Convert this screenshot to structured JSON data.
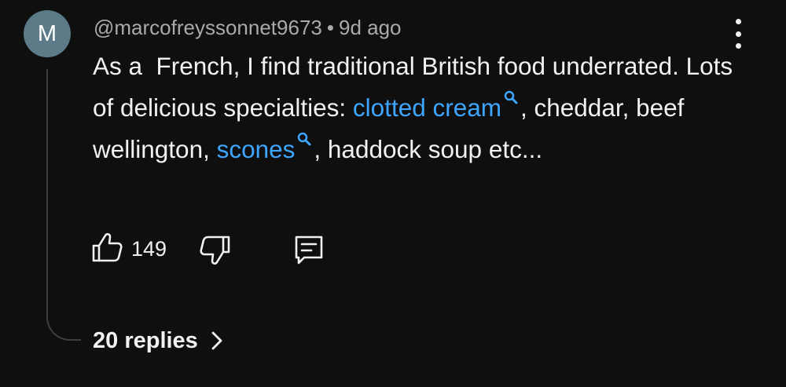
{
  "comment": {
    "avatar_letter": "M",
    "author": "@marcofreyssonnet9673",
    "separator": "•",
    "time": "9d ago",
    "text_part1": "As a  French, I find traditional British food underrated. Lots of delicious specialties: ",
    "link1": "clotted cream",
    "text_part2": ", cheddar, beef wellington, ",
    "link2": "scones",
    "text_part3": ", haddock soup etc...",
    "likes": "149",
    "replies_label": "20 replies"
  },
  "colors": {
    "background": "#0f0f0f",
    "link": "#3ea6ff",
    "avatar": "#5c7a87",
    "text": "#f1f1f1",
    "meta": "#aaaaaa"
  },
  "icons": {
    "like": "thumbs-up-icon",
    "dislike": "thumbs-down-icon",
    "reply": "comment-icon",
    "more": "vertical-ellipsis-icon",
    "search": "search-icon",
    "chevron": "chevron-right-icon"
  }
}
